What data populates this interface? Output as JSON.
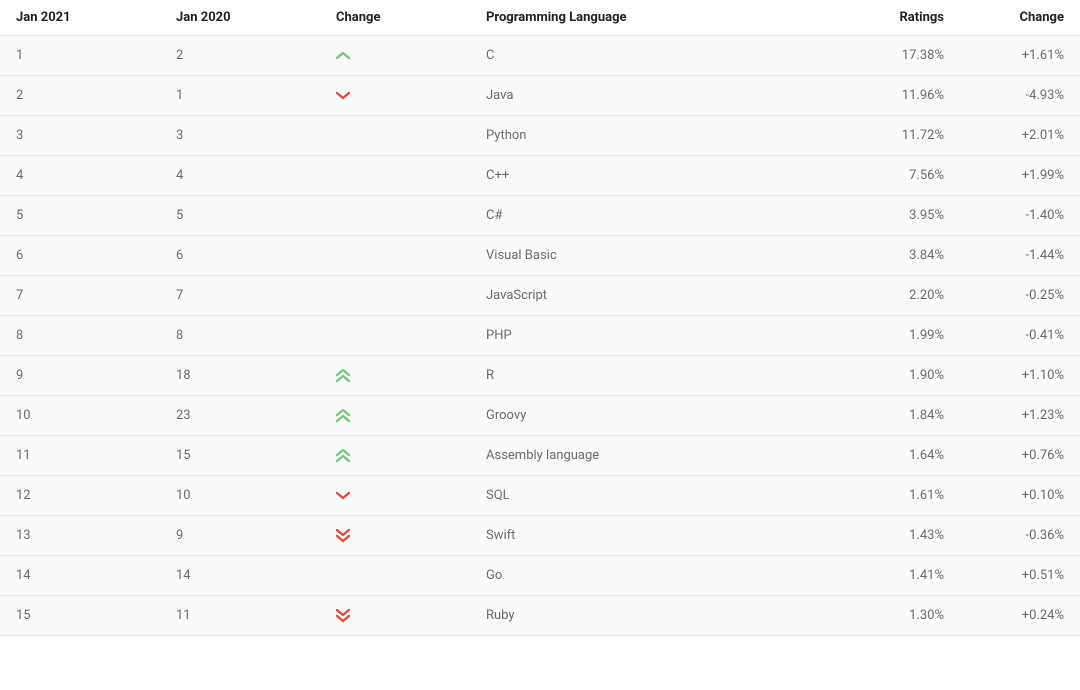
{
  "columns": {
    "jan2021": "Jan 2021",
    "jan2020": "Jan 2020",
    "change_dir": "Change",
    "language": "Programming Language",
    "ratings": "Ratings",
    "change_pct": "Change"
  },
  "colors": {
    "up": "#7cc47f",
    "down": "#e24a3a"
  },
  "rows": [
    {
      "jan2021": "1",
      "jan2020": "2",
      "change_dir": "up",
      "language": "C",
      "ratings": "17.38%",
      "change_pct": "+1.61%"
    },
    {
      "jan2021": "2",
      "jan2020": "1",
      "change_dir": "down",
      "language": "Java",
      "ratings": "11.96%",
      "change_pct": "-4.93%"
    },
    {
      "jan2021": "3",
      "jan2020": "3",
      "change_dir": "same",
      "language": "Python",
      "ratings": "11.72%",
      "change_pct": "+2.01%"
    },
    {
      "jan2021": "4",
      "jan2020": "4",
      "change_dir": "same",
      "language": "C++",
      "ratings": "7.56%",
      "change_pct": "+1.99%"
    },
    {
      "jan2021": "5",
      "jan2020": "5",
      "change_dir": "same",
      "language": "C#",
      "ratings": "3.95%",
      "change_pct": "-1.40%"
    },
    {
      "jan2021": "6",
      "jan2020": "6",
      "change_dir": "same",
      "language": "Visual Basic",
      "ratings": "3.84%",
      "change_pct": "-1.44%"
    },
    {
      "jan2021": "7",
      "jan2020": "7",
      "change_dir": "same",
      "language": "JavaScript",
      "ratings": "2.20%",
      "change_pct": "-0.25%"
    },
    {
      "jan2021": "8",
      "jan2020": "8",
      "change_dir": "same",
      "language": "PHP",
      "ratings": "1.99%",
      "change_pct": "-0.41%"
    },
    {
      "jan2021": "9",
      "jan2020": "18",
      "change_dir": "up2",
      "language": "R",
      "ratings": "1.90%",
      "change_pct": "+1.10%"
    },
    {
      "jan2021": "10",
      "jan2020": "23",
      "change_dir": "up2",
      "language": "Groovy",
      "ratings": "1.84%",
      "change_pct": "+1.23%"
    },
    {
      "jan2021": "11",
      "jan2020": "15",
      "change_dir": "up2",
      "language": "Assembly language",
      "ratings": "1.64%",
      "change_pct": "+0.76%"
    },
    {
      "jan2021": "12",
      "jan2020": "10",
      "change_dir": "down",
      "language": "SQL",
      "ratings": "1.61%",
      "change_pct": "+0.10%"
    },
    {
      "jan2021": "13",
      "jan2020": "9",
      "change_dir": "down2",
      "language": "Swift",
      "ratings": "1.43%",
      "change_pct": "-0.36%"
    },
    {
      "jan2021": "14",
      "jan2020": "14",
      "change_dir": "same",
      "language": "Go",
      "ratings": "1.41%",
      "change_pct": "+0.51%"
    },
    {
      "jan2021": "15",
      "jan2020": "11",
      "change_dir": "down2",
      "language": "Ruby",
      "ratings": "1.30%",
      "change_pct": "+0.24%"
    }
  ]
}
